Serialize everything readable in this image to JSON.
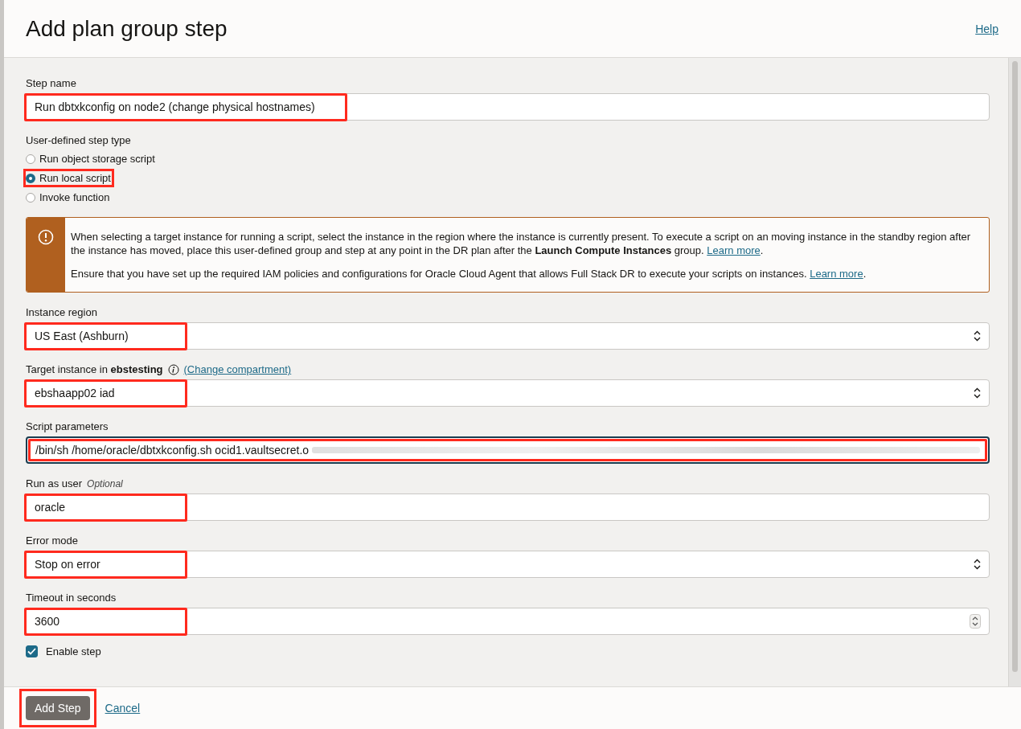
{
  "dialog": {
    "title": "Add plan group step",
    "help_link": "Help"
  },
  "form": [
    {
      "kind": "text",
      "label": "Step name",
      "value": "Run dbtxkconfig on node2 (change physical hostnames)",
      "highlighted": true
    },
    {
      "kind": "radio",
      "label": "User-defined step type",
      "options": [
        {
          "label": "Run object storage script",
          "selected": false,
          "highlighted": false
        },
        {
          "label": "Run local script",
          "selected": true,
          "highlighted": true
        },
        {
          "label": "Invoke function",
          "selected": false,
          "highlighted": false
        }
      ]
    },
    {
      "kind": "notice",
      "paragraphs": [
        {
          "text": "When selecting a target instance for running a script, select the instance in the region where the instance is currently present. To execute a script on an moving instance in the standby region after the instance has moved, place this user-defined group and step at any point in the DR plan after the **Launch Compute Instances** group.",
          "link": "Learn more",
          "after": "."
        },
        {
          "text": "Ensure that you have set up the required IAM policies and configurations for Oracle Cloud Agent that allows Full Stack DR to execute your scripts on instances.",
          "link": "Learn more",
          "after": "."
        }
      ]
    },
    {
      "kind": "select",
      "label": "Instance region",
      "value": "US East (Ashburn)",
      "highlighted": true
    },
    {
      "kind": "select",
      "label": "Target instance in **ebstesting**",
      "link": "(Change compartment)",
      "value": "ebshaapp02 iad",
      "highlighted": true
    },
    {
      "kind": "text",
      "label": "Script parameters",
      "value": "/bin/sh /home/oracle/dbtxkconfig.sh ocid1.vaultsecret.o",
      "redacted": true,
      "focused": true,
      "highlighted": true
    },
    {
      "kind": "text",
      "label": "Run as user",
      "hint": "Optional",
      "value": "oracle",
      "highlighted": true
    },
    {
      "kind": "select",
      "label": "Error mode",
      "value": "Stop on error",
      "highlighted": true
    },
    {
      "kind": "number",
      "label": "Timeout in seconds",
      "value": "3600",
      "highlighted": true
    },
    {
      "kind": "checkbox",
      "label": "Enable step",
      "checked": true
    }
  ],
  "footer": {
    "primary": {
      "label": "Add Step",
      "highlighted": true
    },
    "cancel": "Cancel"
  }
}
